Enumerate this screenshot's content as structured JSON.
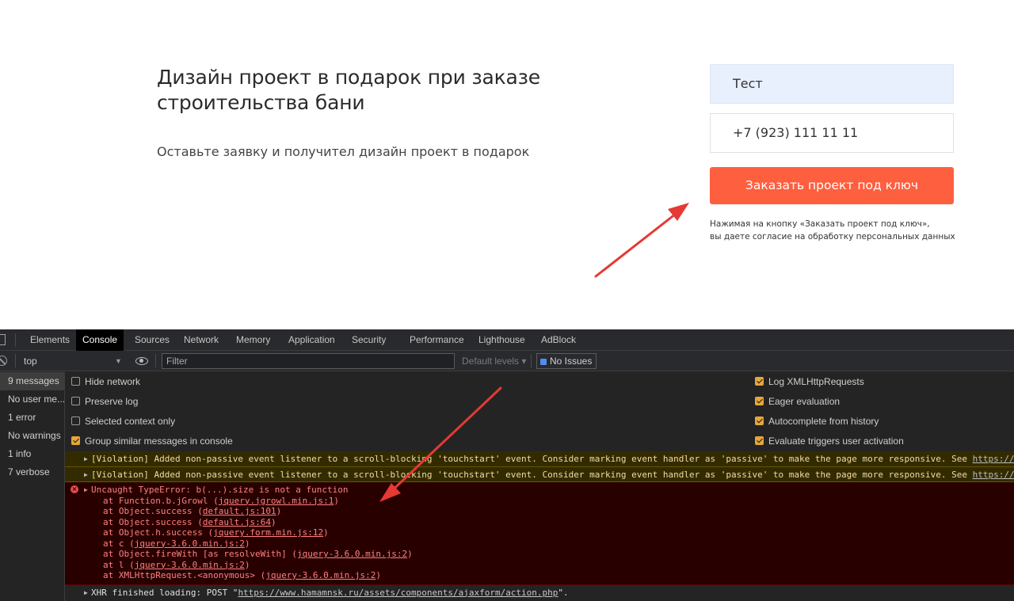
{
  "page": {
    "heading": "Дизайн проект в подарок при заказе строительства бани",
    "subtext": "Оставьте заявку и получител дизайн проект в подарок",
    "name_value": "Тест",
    "phone_value": "+7 (923) 111 11 11",
    "order_button": "Заказать проект под ключ",
    "consent_line1": "Нажимая на кнопку «Заказать проект под ключ»,",
    "consent_line2": "вы даете согласие на обработку персональных данных"
  },
  "devtools": {
    "tabs": [
      "Elements",
      "Console",
      "Sources",
      "Network",
      "Memory",
      "Application",
      "Security",
      "Performance",
      "Lighthouse",
      "AdBlock"
    ],
    "active_tab": "Console",
    "toolbar": {
      "context": "top",
      "filter_placeholder": "Filter",
      "levels": "Default levels ▾",
      "issues": "No Issues"
    },
    "sidebar": [
      "9 messages",
      "No user me...",
      "1 error",
      "No warnings",
      "1 info",
      "7 verbose"
    ],
    "settings_left": [
      {
        "label": "Hide network",
        "checked": false
      },
      {
        "label": "Preserve log",
        "checked": false
      },
      {
        "label": "Selected context only",
        "checked": false
      },
      {
        "label": "Group similar messages in console",
        "checked": true
      }
    ],
    "settings_right": [
      {
        "label": "Log XMLHttpRequests",
        "checked": true
      },
      {
        "label": "Eager evaluation",
        "checked": true
      },
      {
        "label": "Autocomplete from history",
        "checked": true
      },
      {
        "label": "Evaluate triggers user activation",
        "checked": true
      }
    ],
    "violation_text": "[Violation] Added non-passive event listener to a scroll-blocking 'touchstart' event. Consider marking event handler as 'passive' to make the page more responsive. See ",
    "violation_link": "https://www.chro",
    "error_head": "Uncaught TypeError: b(...).size is not a function",
    "stack": [
      {
        "pre": "at Function.b.jGrowl (",
        "link": "jquery.jgrowl.min.js:1",
        "post": ")"
      },
      {
        "pre": "at Object.success (",
        "link": "default.js:101",
        "post": ")"
      },
      {
        "pre": "at Object.success (",
        "link": "default.js:64",
        "post": ")"
      },
      {
        "pre": "at Object.h.success (",
        "link": "jquery.form.min.js:12",
        "post": ")"
      },
      {
        "pre": "at c (",
        "link": "jquery-3.6.0.min.js:2",
        "post": ")"
      },
      {
        "pre": "at Object.fireWith [as resolveWith] (",
        "link": "jquery-3.6.0.min.js:2",
        "post": ")"
      },
      {
        "pre": "at l (",
        "link": "jquery-3.6.0.min.js:2",
        "post": ")"
      },
      {
        "pre": "at XMLHttpRequest.<anonymous> (",
        "link": "jquery-3.6.0.min.js:2",
        "post": ")"
      }
    ],
    "xhr_pre": "XHR finished loading: POST \"",
    "xhr_link": "https://www.hamamnsk.ru/assets/components/ajaxform/action.php",
    "xhr_post": "\"."
  },
  "colors": {
    "accent_button": "#fe5f3f",
    "arrow": "#e53935",
    "warning_bg": "#332b00",
    "error_bg": "#290000"
  }
}
